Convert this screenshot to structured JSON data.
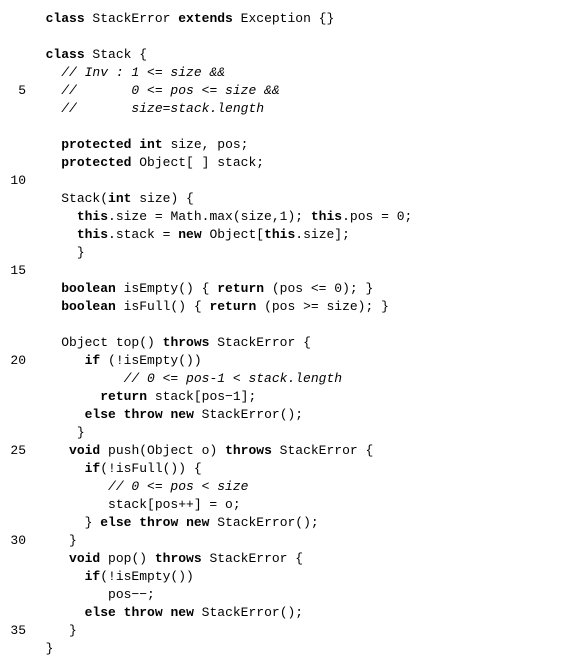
{
  "gutter": {
    "5": "5",
    "10": "10",
    "15": "15",
    "20": "20",
    "25": "25",
    "30": "30",
    "35": "35"
  },
  "code": {
    "l1": {
      "kw1": "class",
      "t1": " StackError ",
      "kw2": "extends",
      "t2": " Exception {}"
    },
    "l2": {
      "t": ""
    },
    "l3": {
      "kw1": "class",
      "t1": " Stack {"
    },
    "l4": {
      "cm": "// Inv : 1 <= size &&"
    },
    "l5": {
      "cm": "//       0 <= pos <= size &&"
    },
    "l6": {
      "cm": "//       size=stack.length"
    },
    "l7": {
      "t": ""
    },
    "l8": {
      "kw1": "protected",
      "t1": " ",
      "kw2": "int",
      "t2": " size, pos;"
    },
    "l9": {
      "kw1": "protected",
      "t1": " Object[ ] stack;"
    },
    "l10": {
      "t": ""
    },
    "l11": {
      "t1": "Stack(",
      "kw1": "int",
      "t2": " size) {"
    },
    "l12": {
      "kw1": "this",
      "t1": ".size = Math.max(size,1); ",
      "kw2": "this",
      "t2": ".pos = 0;"
    },
    "l13": {
      "kw1": "this",
      "t1": ".stack = ",
      "kw2": "new",
      "t2": " Object[",
      "kw3": "this",
      "t3": ".size];"
    },
    "l14": {
      "t": "}"
    },
    "l15": {
      "t": ""
    },
    "l16": {
      "kw1": "boolean",
      "t1": " isEmpty() { ",
      "kw2": "return",
      "t2": " (pos <= 0); }"
    },
    "l17": {
      "kw1": "boolean",
      "t1": " isFull() { ",
      "kw2": "return",
      "t2": " (pos >= size); }"
    },
    "l18": {
      "t": ""
    },
    "l19": {
      "t1": "Object top() ",
      "kw1": "throws",
      "t2": " StackError {"
    },
    "l20": {
      "kw1": "if",
      "t1": " (!isEmpty())"
    },
    "l21": {
      "cm": "// 0 <= pos-1 < stack.length"
    },
    "l22": {
      "kw1": "return",
      "t1": " stack[pos−1];"
    },
    "l23": {
      "kw1": "else",
      "t1": " ",
      "kw2": "throw",
      "t2": " ",
      "kw3": "new",
      "t3": " StackError();"
    },
    "l24": {
      "t": "}"
    },
    "l25": {
      "kw1": "void",
      "t1": " push(Object o) ",
      "kw2": "throws",
      "t2": " StackError {"
    },
    "l26": {
      "kw1": "if",
      "t1": "(!isFull()) {"
    },
    "l27": {
      "cm": "// 0 <= pos < size"
    },
    "l28": {
      "t": "stack[pos++] = o;"
    },
    "l29": {
      "t1": "} ",
      "kw1": "else",
      "t2": " ",
      "kw2": "throw",
      "t3": " ",
      "kw3": "new",
      "t4": " StackError();"
    },
    "l30": {
      "t": "}"
    },
    "l31": {
      "kw1": "void",
      "t1": " pop() ",
      "kw2": "throws",
      "t2": " StackError {"
    },
    "l32": {
      "kw1": "if",
      "t1": "(!isEmpty())"
    },
    "l33": {
      "t": "pos−−;"
    },
    "l34": {
      "kw1": "else",
      "t1": " ",
      "kw2": "throw",
      "t2": " ",
      "kw3": "new",
      "t3": " StackError();"
    },
    "l35": {
      "t": "}"
    },
    "l36": {
      "t": "}"
    }
  },
  "indent": {
    "l1": "  ",
    "l2": "",
    "l3": "  ",
    "l4": "    ",
    "l5": "    ",
    "l6": "    ",
    "l7": "",
    "l8": "    ",
    "l9": "    ",
    "l10": "",
    "l11": "    ",
    "l12": "      ",
    "l13": "      ",
    "l14": "      ",
    "l15": "",
    "l16": "    ",
    "l17": "    ",
    "l18": "",
    "l19": "    ",
    "l20": "       ",
    "l21": "            ",
    "l22": "         ",
    "l23": "       ",
    "l24": "      ",
    "l25": "     ",
    "l26": "       ",
    "l27": "          ",
    "l28": "          ",
    "l29": "       ",
    "l30": "     ",
    "l31": "     ",
    "l32": "       ",
    "l33": "          ",
    "l34": "       ",
    "l35": "     ",
    "l36": "  "
  }
}
